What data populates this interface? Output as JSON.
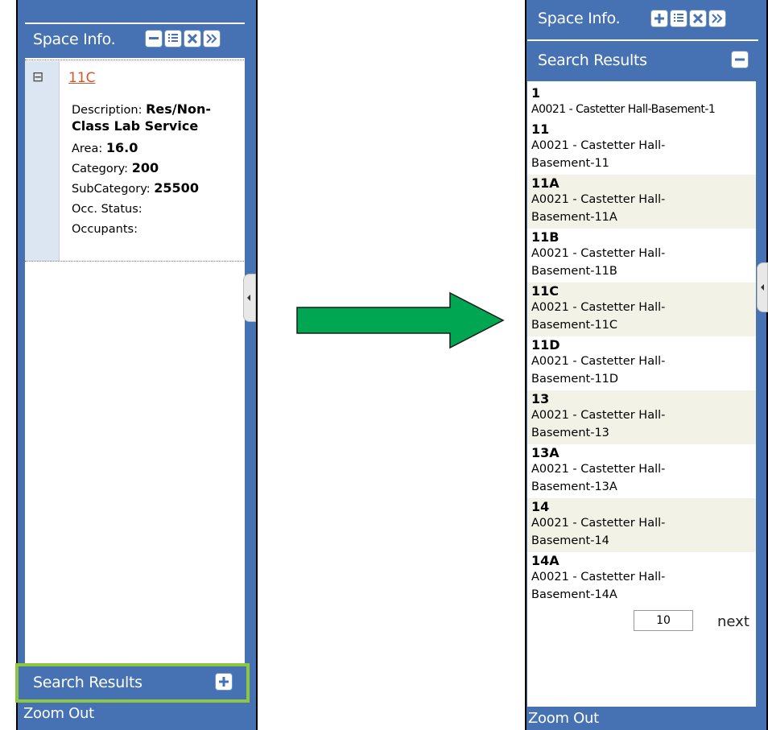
{
  "left_panel": {
    "title": "Space Info.",
    "tree_toggle": "⊟",
    "space_link": "11C",
    "details": [
      {
        "label": "Description:",
        "value": "Res/Non-Class Lab Service"
      },
      {
        "label": "Area:",
        "value": "16.0"
      },
      {
        "label": "Category:",
        "value": "200"
      },
      {
        "label": "SubCategory:",
        "value": "25500"
      },
      {
        "label": "Occ. Status:",
        "value": ""
      },
      {
        "label": "Occupants:",
        "value": ""
      }
    ],
    "search_results_label": "Search Results",
    "zoom_out_label": "Zoom Out",
    "highlight_color": "#8dc63f"
  },
  "arrow": {
    "color": "#00a651"
  },
  "right_panel": {
    "title": "Space Info.",
    "search_results_label": "Search Results",
    "results": [
      {
        "id": "1",
        "location": "A0021 - Castetter Hall-Basement-1"
      },
      {
        "id": "11",
        "location": "A0021 - Castetter Hall-Basement-11"
      },
      {
        "id": "11A",
        "location": "A0021 - Castetter Hall-Basement-11A"
      },
      {
        "id": "11B",
        "location": "A0021 - Castetter Hall-Basement-11B"
      },
      {
        "id": "11C",
        "location": "A0021 - Castetter Hall-Basement-11C"
      },
      {
        "id": "11D",
        "location": "A0021 - Castetter Hall-Basement-11D"
      },
      {
        "id": "13",
        "location": "A0021 - Castetter Hall-Basement-13"
      },
      {
        "id": "13A",
        "location": "A0021 - Castetter Hall-Basement-13A"
      },
      {
        "id": "14",
        "location": "A0021 - Castetter Hall-Basement-14"
      },
      {
        "id": "14A",
        "location": "A0021 - Castetter Hall-Basement-14A"
      }
    ],
    "page_size_value": "10",
    "next_label": "next",
    "zoom_out_label": "Zoom Out"
  },
  "colors": {
    "header_blue": "#4672b3",
    "row_alt": "#f2f2e6",
    "tree_gutter": "#dce5f2"
  }
}
